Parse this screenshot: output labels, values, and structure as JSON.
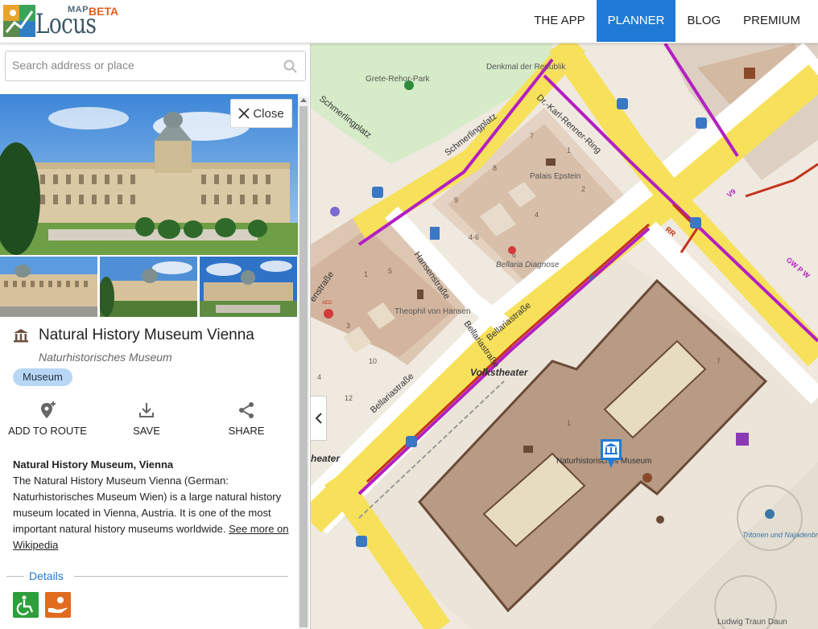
{
  "header": {
    "logo_map": "MAP",
    "logo_locus": "Locus",
    "logo_beta": "BETA",
    "nav": [
      {
        "label": "THE APP",
        "active": false
      },
      {
        "label": "PLANNER",
        "active": true
      },
      {
        "label": "BLOG",
        "active": false
      },
      {
        "label": "PREMIUM",
        "active": false
      }
    ]
  },
  "search": {
    "placeholder": "Search address or place",
    "value": ""
  },
  "poi": {
    "close_label": "Close",
    "title": "Natural History Museum Vienna",
    "subtitle": "Naturhistorisches Museum",
    "tag": "Museum",
    "actions": {
      "add_to_route": "ADD TO ROUTE",
      "save": "SAVE",
      "share": "SHARE"
    },
    "description": {
      "title": "Natural History Museum, Vienna",
      "text": "The Natural History Museum Vienna (German: Naturhistorisches Museum Wien) is a large natural history museum located in Vienna, Austria. It is one of the most important natural history museums worldwide.",
      "more_link": "See more on Wikipedia"
    },
    "details_label": "Details",
    "features": [
      "wheelchair-icon",
      "donation-icon"
    ]
  },
  "map": {
    "labels": {
      "grete_rehor": "Grete-Rehor-Park",
      "denkmal": "Denkmal der Republik",
      "schmerlingplatz": "Schmerlingplatz",
      "schmerlingplatz_left": "Schmerlingplatz",
      "renner_ring": "Dr.-Karl-Renner-Ring",
      "palais": "Palais Epstein",
      "hansenstrasse": "Hansenstraße",
      "hansenstrasse_left": "enstraße",
      "bellaria_diagnose": "Bellaria Diagnose",
      "bellariastrasse_1": "Bellariastraße",
      "bellariastrasse_2": "Bellariastraße",
      "bellariastrasse_3": "Bellariastraße",
      "theophil": "Theophil von Hansen",
      "volkstheater": "Volkstheater",
      "volkstheater_left": "heater",
      "museum_label": "Naturhistorisches Museum",
      "tritonen": "Tritonen und Najadenbrunnen",
      "route_gw": "GW P W",
      "route_rr": "RR",
      "route_v9": "V9",
      "ludwig": "Ludwig Traun Daun",
      "aed": "AED"
    },
    "house_numbers": [
      "7",
      "1",
      "8",
      "2",
      "9",
      "4",
      "4-6",
      "6",
      "1",
      "5",
      "3",
      "10",
      "4",
      "12",
      "1",
      "7"
    ]
  },
  "colors": {
    "accent": "#1f7bd5",
    "beta": "#e65e1f",
    "tag_bg": "#b8d7f5",
    "road_major": "#f7e15a",
    "route_purple": "#b41fc2",
    "route_red": "#c4331a",
    "building": "#b89b85",
    "map_bg": "#efe9df",
    "park": "#d6ebc8",
    "wheelchair": "#2e9e3a",
    "donation": "#e06c1e"
  }
}
